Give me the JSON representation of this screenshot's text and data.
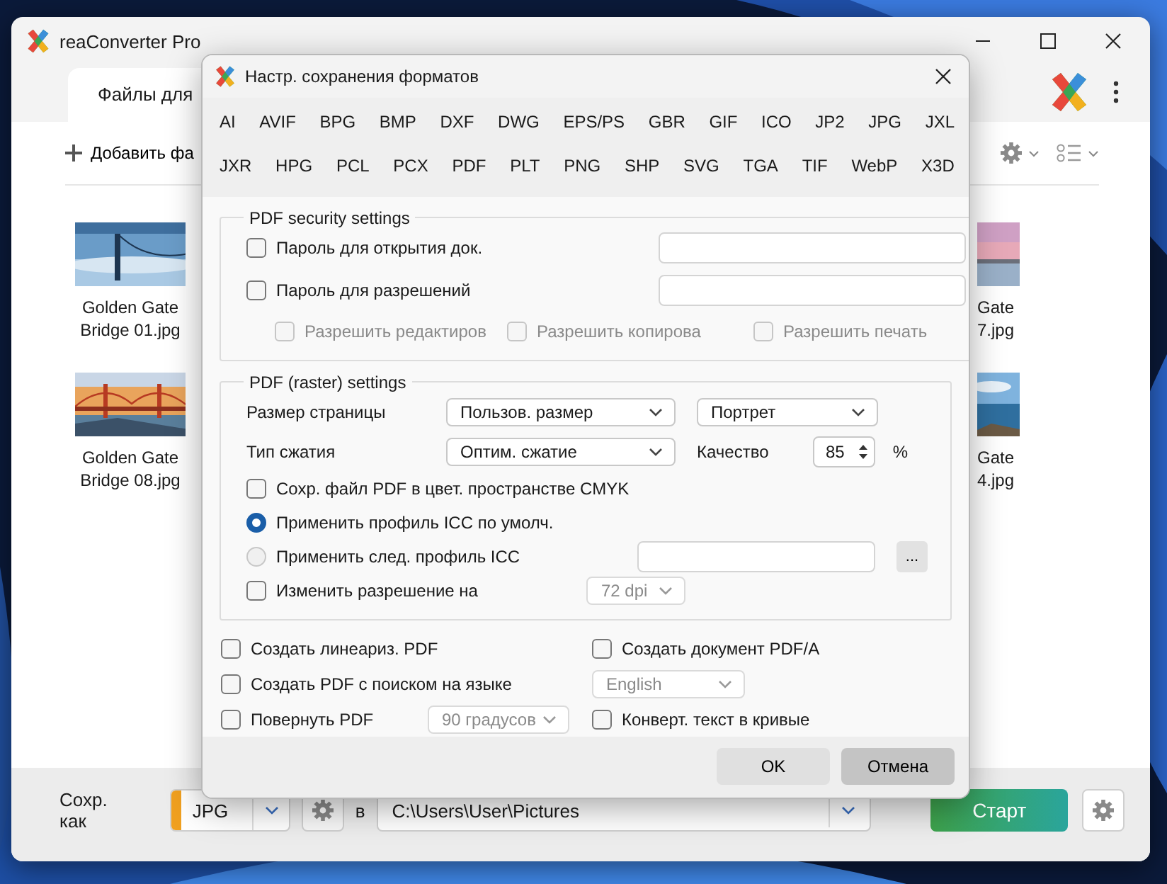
{
  "app": {
    "title": "reaConverter Pro"
  },
  "main_tab": {
    "label": "Файлы для"
  },
  "toolbar": {
    "add_label": "Добавить фа"
  },
  "files_left": [
    {
      "name_lines": [
        "Golden Gate",
        "Bridge 01.jpg"
      ]
    },
    {
      "name_lines": [
        "Golden Gate",
        "Bridge 08.jpg"
      ]
    }
  ],
  "files_right": [
    {
      "name_lines": [
        "Gate",
        "7.jpg"
      ]
    },
    {
      "name_lines": [
        "Gate",
        "4.jpg"
      ]
    }
  ],
  "save_bar": {
    "label": "Сохр. как",
    "format": "JPG",
    "in_label": "в",
    "path": "C:\\Users\\User\\Pictures",
    "start": "Старт"
  },
  "dialog": {
    "title": "Настр. сохранения форматов",
    "format_rows": [
      [
        "AI",
        "AVIF",
        "BPG",
        "BMP",
        "DXF",
        "DWG",
        "EPS/PS",
        "GBR",
        "GIF",
        "ICO",
        "JP2",
        "JPG",
        "JXL"
      ],
      [
        "JXR",
        "HPG",
        "PCL",
        "PCX",
        "PDF",
        "PLT",
        "PNG",
        "SHP",
        "SVG",
        "TGA",
        "TIF",
        "WebP",
        "X3D"
      ]
    ],
    "security": {
      "title": "PDF security settings",
      "passwords": [
        {
          "label": "Пароль для открытия док.",
          "checked": false
        },
        {
          "label": "Пароль для разрешений",
          "checked": false
        }
      ],
      "permissions": [
        {
          "label": "Разрешить редактиров",
          "checked": false,
          "disabled": true
        },
        {
          "label": "Разрешить копирова",
          "checked": false,
          "disabled": true
        },
        {
          "label": "Разрешить печать",
          "checked": false,
          "disabled": true
        }
      ]
    },
    "raster": {
      "title": "PDF (raster) settings",
      "page_size_label": "Размер страницы",
      "page_size": {
        "value": "Пользов. размер",
        "disabled": false
      },
      "orientation": {
        "value": "Портрет",
        "disabled": false
      },
      "compression_label": "Тип сжатия",
      "compression": {
        "value": "Оптим. сжатие",
        "disabled": false
      },
      "quality_label": "Качество",
      "quality": "85",
      "quality_unit": "%",
      "cmyk": {
        "label": "Сохр. файл PDF в цвет. пространстве CMYK",
        "checked": false
      },
      "icc_options": [
        {
          "label": "Применить профиль ICC по умолч.",
          "selected": true
        },
        {
          "label": "Применить след. профиль ICC",
          "selected": false
        }
      ],
      "browse": "...",
      "resolution": {
        "label": "Изменить разрешение на",
        "checked": false
      },
      "dpi": {
        "value": "72 dpi",
        "disabled": true
      }
    },
    "linearize": {
      "label": "Создать линеариз. PDF",
      "checked": false
    },
    "pdfa": {
      "label": "Создать документ PDF/A",
      "checked": false
    },
    "searchable": {
      "label": "Создать PDF с поиском на языке",
      "checked": false
    },
    "language": {
      "value": "English",
      "disabled": true
    },
    "rotate": {
      "label": "Повернуть PDF",
      "checked": false
    },
    "rotation": {
      "value": "90 градусов",
      "disabled": true
    },
    "curves": {
      "label": "Конверт. текст в кривые",
      "checked": false
    },
    "buttons": [
      {
        "label": "OK",
        "kind": "ok"
      },
      {
        "label": "Отмена",
        "kind": "cancel"
      }
    ]
  }
}
